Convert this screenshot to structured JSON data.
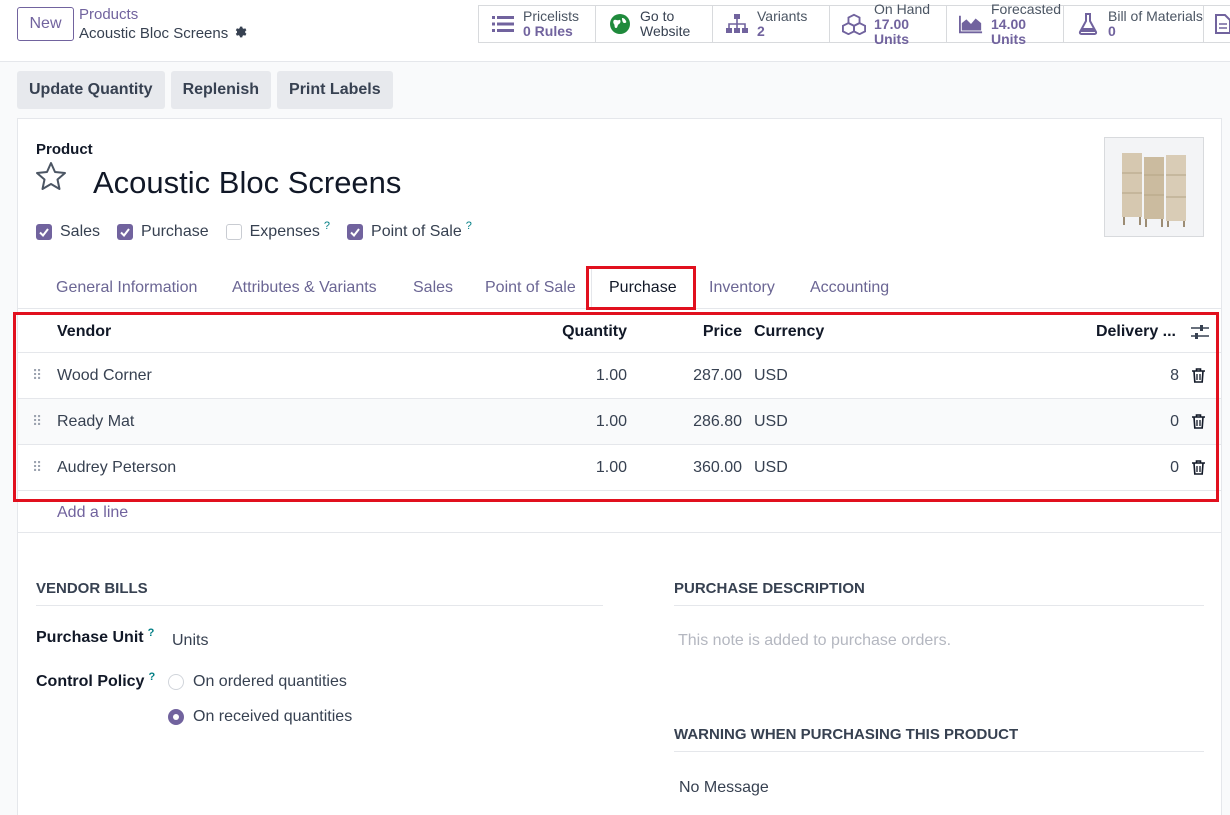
{
  "control_panel": {
    "new_label": "New",
    "breadcrumb_parent": "Products",
    "breadcrumb_current": "Acoustic Bloc Screens"
  },
  "smart_buttons": [
    {
      "line1": "Pricelists",
      "line2": "0 Rules",
      "icon": "list-icon"
    },
    {
      "line1": "Go to",
      "line2": "Website",
      "icon": "globe-icon"
    },
    {
      "line1": "Variants",
      "line2": "2",
      "icon": "sitemap-icon"
    },
    {
      "line1": "On Hand",
      "line2": "17.00 Units",
      "icon": "cubes-icon"
    },
    {
      "line1": "Forecasted",
      "line2": "14.00 Units",
      "icon": "area-chart-icon"
    },
    {
      "line1": "Bill of Materials",
      "line2": "0",
      "icon": "flask-icon"
    }
  ],
  "actions": {
    "update_quantity": "Update Quantity",
    "replenish": "Replenish",
    "print_labels": "Print Labels"
  },
  "form": {
    "product_label": "Product",
    "product_name": "Acoustic Bloc Screens",
    "checkboxes": [
      {
        "label": "Sales",
        "checked": true
      },
      {
        "label": "Purchase",
        "checked": true
      },
      {
        "label": "Expenses",
        "checked": false,
        "help": "?"
      },
      {
        "label": "Point of Sale",
        "checked": true,
        "help": "?"
      }
    ],
    "tabs": [
      "General Information",
      "Attributes & Variants",
      "Sales",
      "Point of Sale",
      "Purchase",
      "Inventory",
      "Accounting"
    ],
    "active_tab": "Purchase"
  },
  "vendor_table": {
    "columns": {
      "vendor": "Vendor",
      "quantity": "Quantity",
      "price": "Price",
      "currency": "Currency",
      "delivery": "Delivery ..."
    },
    "rows": [
      {
        "vendor": "Wood Corner",
        "quantity": "1.00",
        "price": "287.00",
        "currency": "USD",
        "delivery": "8"
      },
      {
        "vendor": "Ready Mat",
        "quantity": "1.00",
        "price": "286.80",
        "currency": "USD",
        "delivery": "0"
      },
      {
        "vendor": "Audrey Peterson",
        "quantity": "1.00",
        "price": "360.00",
        "currency": "USD",
        "delivery": "0"
      }
    ],
    "add_line": "Add a line"
  },
  "vendor_bills": {
    "title": "VENDOR BILLS",
    "purchase_unit_label": "Purchase Unit",
    "purchase_unit_value": "Units",
    "control_policy_label": "Control Policy",
    "option_ordered": "On ordered quantities",
    "option_received": "On received quantities",
    "selected": "On received quantities"
  },
  "purchase_description": {
    "title": "PURCHASE DESCRIPTION",
    "placeholder": "This note is added to purchase orders."
  },
  "warning": {
    "title": "WARNING WHEN PURCHASING THIS PRODUCT",
    "value": "No Message"
  },
  "colors": {
    "accent": "#71639e",
    "highlight": "#e1101e",
    "help": "#017e84"
  }
}
